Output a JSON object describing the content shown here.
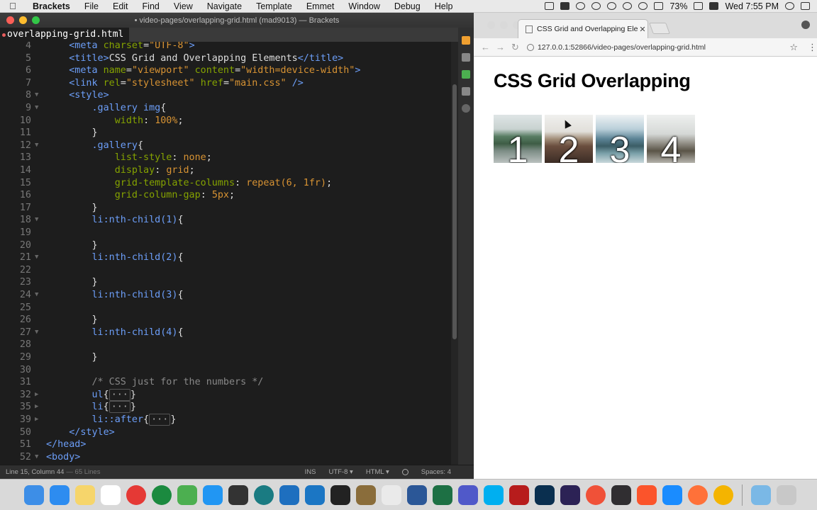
{
  "menubar": {
    "app": "Brackets",
    "items": [
      "File",
      "Edit",
      "Find",
      "View",
      "Navigate",
      "Template",
      "Emmet",
      "Window",
      "Debug",
      "Help"
    ],
    "battery": "73%",
    "clock": "Wed 7:55 PM"
  },
  "editor": {
    "window_title": "• video-pages/overlapping-grid.html (mad9013) — Brackets",
    "tab": "overlapping-grid.html",
    "lines": [
      {
        "n": "4",
        "fold": "",
        "html": "<span class='t-tag'>&lt;meta</span> <span class='t-attr'>charset</span>=<span class='t-str'>\"UTF-8\"</span><span class='t-tag'>&gt;</span>",
        "indent": "    "
      },
      {
        "n": "5",
        "fold": "",
        "indent": "    ",
        "html": "<span class='t-tag'>&lt;title&gt;</span><span class='t-txt'>CSS Grid and Overlapping Elements</span><span class='t-tag'>&lt;/title&gt;</span>"
      },
      {
        "n": "6",
        "fold": "",
        "indent": "    ",
        "html": "<span class='t-tag'>&lt;meta</span> <span class='t-attr'>name</span>=<span class='t-str'>\"viewport\"</span> <span class='t-attr'>content</span>=<span class='t-str'>\"width=device-width\"</span><span class='t-tag'>&gt;</span>"
      },
      {
        "n": "7",
        "fold": "",
        "indent": "    ",
        "html": "<span class='t-tag'>&lt;link</span> <span class='t-attr'>rel</span>=<span class='t-str'>\"stylesheet\"</span> <span class='t-attr'>href</span>=<span class='t-str'>\"main.css\"</span> <span class='t-tag'>/&gt;</span>"
      },
      {
        "n": "8",
        "fold": "▼",
        "indent": "    ",
        "html": "<span class='t-tag'>&lt;style&gt;</span>"
      },
      {
        "n": "9",
        "fold": "▼",
        "indent": "        ",
        "html": "<span class='t-sel'>.gallery img</span>{"
      },
      {
        "n": "10",
        "fold": "",
        "indent": "            ",
        "html": "<span class='t-prop'>width</span>: <span class='t-val'>100%</span>;"
      },
      {
        "n": "11",
        "fold": "",
        "indent": "        ",
        "html": "}"
      },
      {
        "n": "12",
        "fold": "▼",
        "indent": "        ",
        "html": "<span class='t-sel'>.gallery</span>{"
      },
      {
        "n": "13",
        "fold": "",
        "indent": "            ",
        "html": "<span class='t-prop'>list-style</span>: <span class='t-val'>none</span>;"
      },
      {
        "n": "14",
        "fold": "",
        "indent": "            ",
        "html": "<span class='t-prop'>display</span>: <span class='t-val'>grid</span>;"
      },
      {
        "n": "15",
        "fold": "",
        "indent": "            ",
        "html": "<span class='t-prop'>grid-template-columns</span>: <span class='t-val'>repeat(6, 1fr)</span>;"
      },
      {
        "n": "16",
        "fold": "",
        "indent": "            ",
        "html": "<span class='t-prop'>grid-column-gap</span>: <span class='t-val'>5px</span>;"
      },
      {
        "n": "17",
        "fold": "",
        "indent": "        ",
        "html": "}"
      },
      {
        "n": "18",
        "fold": "▼",
        "indent": "        ",
        "html": "<span class='t-sel'>li:nth-child(1)</span>{"
      },
      {
        "n": "19",
        "fold": "",
        "indent": "",
        "html": ""
      },
      {
        "n": "20",
        "fold": "",
        "indent": "        ",
        "html": "}"
      },
      {
        "n": "21",
        "fold": "▼",
        "indent": "        ",
        "html": "<span class='t-sel'>li:nth-child(2)</span>{"
      },
      {
        "n": "22",
        "fold": "",
        "indent": "",
        "html": ""
      },
      {
        "n": "23",
        "fold": "",
        "indent": "        ",
        "html": "}"
      },
      {
        "n": "24",
        "fold": "▼",
        "indent": "        ",
        "html": "<span class='t-sel'>li:nth-child(3)</span>{"
      },
      {
        "n": "25",
        "fold": "",
        "indent": "",
        "html": ""
      },
      {
        "n": "26",
        "fold": "",
        "indent": "        ",
        "html": "}"
      },
      {
        "n": "27",
        "fold": "▼",
        "indent": "        ",
        "html": "<span class='t-sel'>li:nth-child(4)</span>{"
      },
      {
        "n": "28",
        "fold": "",
        "indent": "",
        "html": ""
      },
      {
        "n": "29",
        "fold": "",
        "indent": "        ",
        "html": "}"
      },
      {
        "n": "30",
        "fold": "",
        "indent": "",
        "html": ""
      },
      {
        "n": "31",
        "fold": "",
        "indent": "        ",
        "html": "<span class='t-cmt'>/* CSS just for the numbers */</span>"
      },
      {
        "n": "32",
        "fold": "▶",
        "indent": "        ",
        "html": "<span class='t-sel'>ul</span>{<span class='t-box'>···</span>}"
      },
      {
        "n": "35",
        "fold": "▶",
        "indent": "        ",
        "html": "<span class='t-sel'>li</span>{<span class='t-box'>···</span>}"
      },
      {
        "n": "39",
        "fold": "▶",
        "indent": "        ",
        "html": "<span class='t-sel'>li::after</span>{<span class='t-box'>···</span>}"
      },
      {
        "n": "50",
        "fold": "",
        "indent": "    ",
        "html": "<span class='t-tag'>&lt;/style&gt;</span>"
      },
      {
        "n": "51",
        "fold": "",
        "indent": "",
        "html": "<span class='t-tag'>&lt;/head&gt;</span>"
      },
      {
        "n": "52",
        "fold": "▼",
        "indent": "",
        "html": "<span class='t-tag'>&lt;body&gt;</span>"
      }
    ],
    "status": {
      "cursor": "Line 15, Column 44",
      "lines": "— 65 Lines",
      "mode": "INS",
      "encoding": "UTF-8",
      "language": "HTML",
      "spaces": "Spaces: 4"
    }
  },
  "browser": {
    "tab_title": "CSS Grid and Overlapping Ele",
    "url": "127.0.0.1:52866/video-pages/overlapping-grid.html",
    "page": {
      "heading": "CSS Grid Overlapping",
      "gallery": [
        "1",
        "2",
        "3",
        "4"
      ]
    }
  },
  "dock": {
    "apps": [
      "finder-icon",
      "app-store-icon",
      "notes-icon",
      "calendar-icon",
      "chrome-icon",
      "sourcetree-icon",
      "tower-icon",
      "files-icon",
      "github-icon",
      "gitkraken-icon",
      "vscode-icon",
      "brackets-icon",
      "terminal-icon",
      "archive-icon",
      "sequel-pro-icon",
      "word-icon",
      "excel-icon",
      "teams-icon",
      "skype-icon",
      "filezilla-icon",
      "photoshop-icon",
      "eclipse-icon",
      "swift-icon",
      "obs-icon",
      "brave-icon",
      "safari-icon",
      "firefox-icon",
      "chrome-canary-icon",
      "downloads-icon",
      "trash-icon"
    ],
    "colors": [
      "#3d8ee7",
      "#2d8cf0",
      "#f6d56b",
      "#ffffff",
      "#e53935",
      "#1b8a3f",
      "#4caf50",
      "#2196f3",
      "#333333",
      "#1a7b82",
      "#1e6fbf",
      "#1b76c4",
      "#222222",
      "#8a6d3b",
      "#eaeaea",
      "#2b5797",
      "#1d7044",
      "#5059c9",
      "#00aff0",
      "#b71c1c",
      "#0a2f4f",
      "#2c2255",
      "#f05138",
      "#302e31",
      "#fb542b",
      "#1a8cff",
      "#ff7139",
      "#f4b400",
      "#7ab8e6",
      "#c8c8c8"
    ]
  }
}
